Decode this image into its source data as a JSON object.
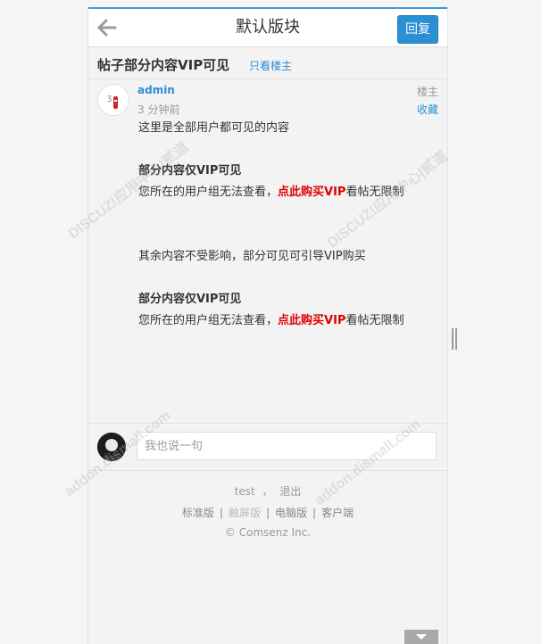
{
  "header": {
    "title": "默认版块",
    "reply_label": "回复"
  },
  "thread": {
    "title": "帖子部分内容VIP可见",
    "only_op_label": "只看楼主"
  },
  "post": {
    "author": "admin",
    "time": "3 分钟前",
    "floor_label": "楼主",
    "favorite_label": "收藏",
    "line_public": "这里是全部用户都可见的内容",
    "vip_heading_1": "部分内容仅VIP可见",
    "vip_notice_prefix_1": "您所在的用户组无法查看，",
    "vip_buy_link_1": "点此购买VIP",
    "vip_notice_suffix_1": "看帖无限制",
    "line_rest": "其余内容不受影响，部分可见可引导VIP购买",
    "vip_heading_2": "部分内容仅VIP可见",
    "vip_notice_prefix_2": "您所在的用户组无法查看，",
    "vip_buy_link_2": "点此购买VIP",
    "vip_notice_suffix_2": "看帖无限制"
  },
  "reply_box": {
    "placeholder": "我也说一句"
  },
  "footer": {
    "username": "test",
    "separator": "，",
    "logout_label": "退出",
    "links": [
      "标准版",
      "触屏版",
      "电脑版",
      "客户端"
    ],
    "copyright": "© Comsenz Inc."
  },
  "watermark": {
    "line1": "DISCUZ!应用中心|贰道",
    "line2": "addon.dismall.com"
  },
  "colors": {
    "accent": "#2b8fd3",
    "vip_link": "#e00000"
  }
}
